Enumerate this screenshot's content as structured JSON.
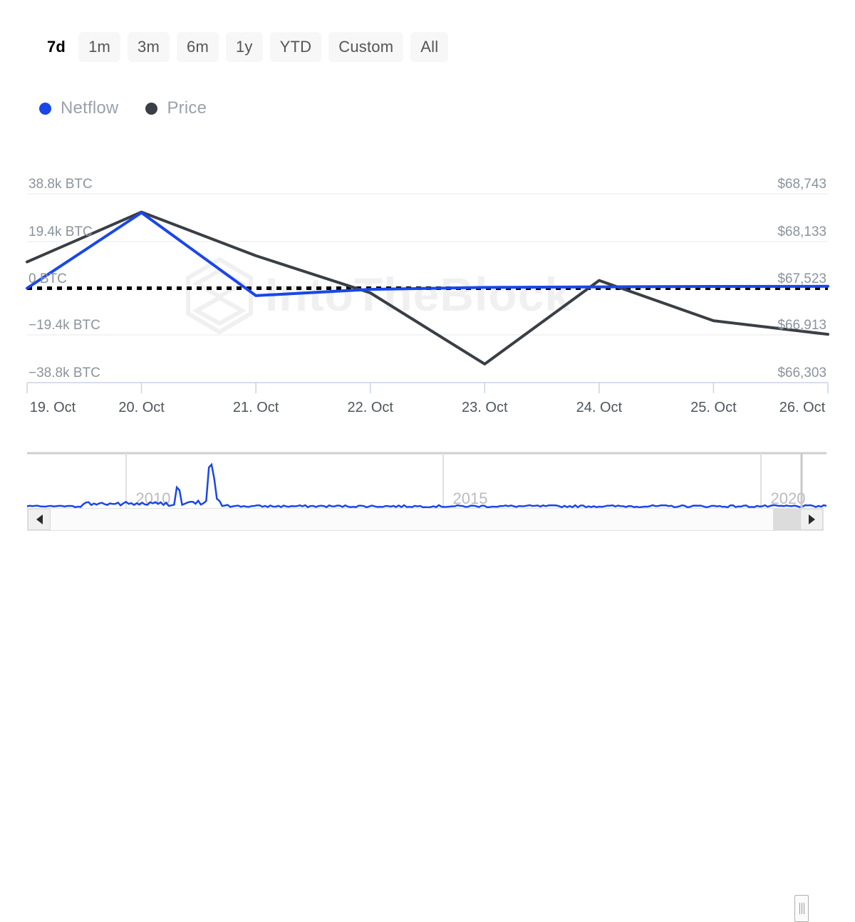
{
  "range_selector": {
    "buttons": [
      {
        "label": "7d",
        "selected": true
      },
      {
        "label": "1m",
        "selected": false
      },
      {
        "label": "3m",
        "selected": false
      },
      {
        "label": "6m",
        "selected": false
      },
      {
        "label": "1y",
        "selected": false
      },
      {
        "label": "YTD",
        "selected": false
      },
      {
        "label": "Custom",
        "selected": false
      },
      {
        "label": "All",
        "selected": false
      }
    ]
  },
  "legend": {
    "items": [
      {
        "label": "Netflow",
        "color": "#1a47e8"
      },
      {
        "label": "Price",
        "color": "#3a3f45"
      }
    ]
  },
  "watermark": {
    "text": "IntoTheBlock",
    "logo": "intotheblock-hexagon-logo"
  },
  "navigator": {
    "year_labels": [
      "2010",
      "2015",
      "2020"
    ],
    "series_color": "#1a47e8",
    "left_arrow": "scroll-left-arrow",
    "right_arrow": "scroll-right-arrow",
    "handle": "navigator-right-handle"
  },
  "chart_data": {
    "type": "line",
    "title": "",
    "xlabel": "",
    "grid": true,
    "legend_position": "top-left",
    "x": [
      "19. Oct",
      "20. Oct",
      "21. Oct",
      "22. Oct",
      "23. Oct",
      "24. Oct",
      "25. Oct",
      "26. Oct"
    ],
    "axes": {
      "left": {
        "label": "Netflow",
        "ticks": [
          "38.8k BTC",
          "19.4k BTC",
          "0 BTC",
          "−19.4k BTC",
          "−38.8k BTC"
        ],
        "tick_values": [
          38800,
          19400,
          0,
          -19400,
          -38800
        ],
        "ylim": [
          -48500,
          48500
        ]
      },
      "right": {
        "label": "Price",
        "ticks": [
          "$68,743",
          "$68,133",
          "$67,523",
          "$66,913",
          "$66,303"
        ],
        "tick_values": [
          68743,
          68133,
          67523,
          66913,
          66303
        ],
        "ylim": [
          66000,
          69050
        ]
      }
    },
    "zero_line": {
      "value": 0,
      "style": "dashed",
      "color": "#000000"
    },
    "series": [
      {
        "name": "Netflow",
        "axis": "left",
        "color": "#1a47e8",
        "unit": "BTC",
        "values": [
          0,
          38800,
          -3800,
          -600,
          400,
          700,
          900,
          1000
        ]
      },
      {
        "name": "Price",
        "axis": "right",
        "color": "#3a3f45",
        "unit": "USD",
        "values": [
          67950,
          68755,
          68050,
          67450,
          66300,
          67650,
          67000,
          66780
        ]
      }
    ]
  }
}
